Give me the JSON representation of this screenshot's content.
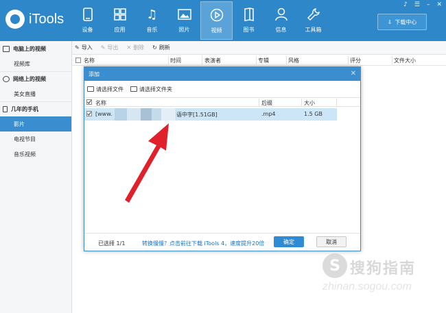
{
  "app": {
    "name": "iTools",
    "download_center": "下载中心"
  },
  "nav": [
    {
      "label": "设备",
      "icon": "phone-icon"
    },
    {
      "label": "应用",
      "icon": "apps-icon"
    },
    {
      "label": "音乐",
      "icon": "music-icon"
    },
    {
      "label": "照片",
      "icon": "photo-icon"
    },
    {
      "label": "视频",
      "icon": "video-icon"
    },
    {
      "label": "图书",
      "icon": "book-icon"
    },
    {
      "label": "信息",
      "icon": "person-icon"
    },
    {
      "label": "工具箱",
      "icon": "wrench-icon"
    }
  ],
  "active_nav": "视频",
  "sidebar": {
    "sections": [
      {
        "title": "电脑上的视频",
        "items": [
          "视频库"
        ]
      },
      {
        "title": "网络上的视频",
        "items": [
          "美女直播"
        ]
      },
      {
        "title": "几年的手机",
        "items": [
          "影片",
          "电视节目",
          "音乐视频"
        ]
      }
    ],
    "active_item": "影片"
  },
  "toolbar": {
    "import": "导入",
    "export": "导出",
    "delete": "删除",
    "refresh": "刷新"
  },
  "table": {
    "columns": [
      "名称",
      "时间",
      "表演者",
      "专辑",
      "风格",
      "评分",
      "文件大小"
    ]
  },
  "dialog": {
    "title": "添加",
    "select_file": "请选择文件",
    "select_folder": "请选择文件夹",
    "columns": {
      "name": "名称",
      "ext": "后缀",
      "size": "大小"
    },
    "row": {
      "name_prefix": "[www.",
      "name_suffix": "语中字[1.51GB]",
      "ext": ".mp4",
      "size": "1.5 GB"
    },
    "selected": "已选择 1/1",
    "hint": "转换慢慢？点击前往下载 iTools 4，速度提升20倍",
    "ok": "确定",
    "cancel": "取消"
  },
  "watermark": {
    "text": "搜狗指南",
    "url": "zhinan.sogou.com",
    "mark": "S"
  },
  "colors": {
    "topbar": "#2e87c8",
    "active_blue": "#3a8ed0",
    "selected_row": "#cde6f7",
    "arrow": "#e0202a"
  }
}
